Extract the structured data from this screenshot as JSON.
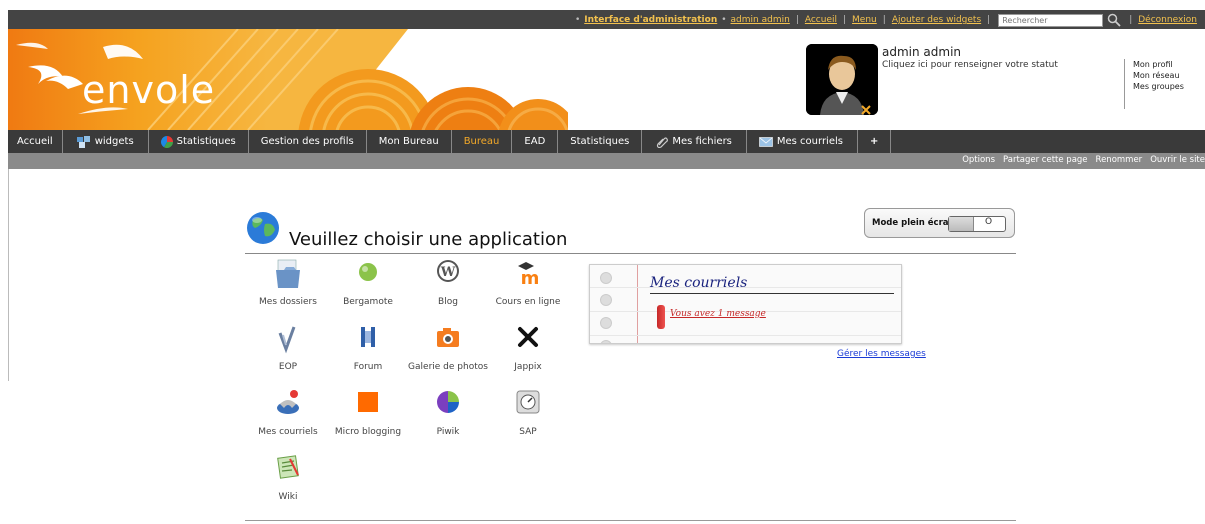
{
  "topbar": {
    "admin_interface": "Interface d'administration",
    "user_link": "admin admin",
    "home": "Accueil",
    "menu": "Menu",
    "add_widgets": "Ajouter des widgets",
    "search_placeholder": "Rechercher",
    "logout": "Déconnexion"
  },
  "banner": {
    "logo_text": "envole",
    "profile_name": "admin admin",
    "profile_status": "Cliquez ici pour renseigner votre statut",
    "profile_menu": [
      "Mon profil",
      "Mon réseau",
      "Mes groupes"
    ]
  },
  "nav": {
    "tabs": [
      {
        "label": "Accueil",
        "icon": ""
      },
      {
        "label": "widgets",
        "icon": "widgets-icon"
      },
      {
        "label": "Statistiques",
        "icon": "stats-pie-icon"
      },
      {
        "label": "Gestion des profils",
        "icon": ""
      },
      {
        "label": "Mon Bureau",
        "icon": ""
      },
      {
        "label": "Bureau",
        "icon": "",
        "active": true
      },
      {
        "label": "EAD",
        "icon": ""
      },
      {
        "label": "Statistiques",
        "icon": ""
      },
      {
        "label": "Mes fichiers",
        "icon": "paperclip-icon"
      },
      {
        "label": "Mes courriels",
        "icon": "envelope-icon"
      },
      {
        "label": "+",
        "icon": ""
      }
    ],
    "active_color": "#f3a928"
  },
  "subnav": {
    "items": [
      "Options",
      "Partager cette page",
      "Renommer",
      "Ouvrir le site"
    ]
  },
  "main": {
    "title": "Veuillez choisir une application",
    "fullscreen_label": "Mode plein écran",
    "toggle_state": "O"
  },
  "apps": [
    {
      "label": "Mes dossiers",
      "icon": "folder-icon"
    },
    {
      "label": "Bergamote",
      "icon": "bergamote-icon"
    },
    {
      "label": "Blog",
      "icon": "wordpress-icon"
    },
    {
      "label": "Cours en ligne",
      "icon": "moodle-icon"
    },
    {
      "label": "EOP",
      "icon": "eop-icon"
    },
    {
      "label": "Forum",
      "icon": "forum-icon"
    },
    {
      "label": "Galerie de photos",
      "icon": "camera-icon"
    },
    {
      "label": "Jappix",
      "icon": "jappix-icon"
    },
    {
      "label": "Mes courriels",
      "icon": "mail-app-icon"
    },
    {
      "label": "Micro blogging",
      "icon": "microblog-icon"
    },
    {
      "label": "Piwik",
      "icon": "piwik-icon"
    },
    {
      "label": "SAP",
      "icon": "sap-icon"
    },
    {
      "label": "Wiki",
      "icon": "wiki-icon"
    }
  ],
  "mail_widget": {
    "title": "Mes courriels",
    "message": "Vous avez 1 message",
    "manage": "Gérer les messages"
  }
}
